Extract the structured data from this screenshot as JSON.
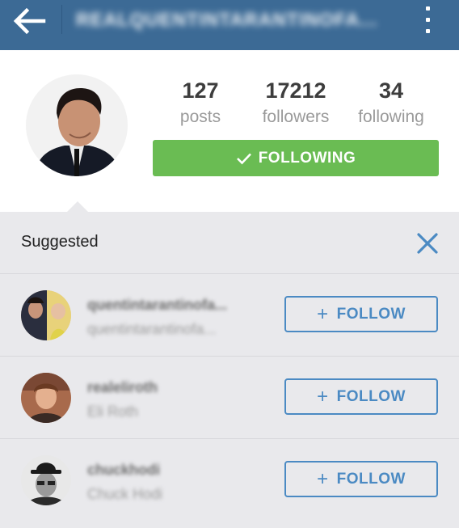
{
  "topbar": {
    "back_icon": "arrow-left-icon",
    "title": "REALQUENTINTARANTINOFA...",
    "menu_icon": "more-vertical-icon"
  },
  "profile": {
    "stats": [
      {
        "value": "127",
        "label": "posts"
      },
      {
        "value": "17212",
        "label": "followers"
      },
      {
        "value": "34",
        "label": "following"
      }
    ],
    "following_button": "FOLLOWING",
    "following_color": "#6abc53"
  },
  "suggested": {
    "title": "Suggested",
    "close_icon": "close-icon",
    "follow_label": "FOLLOW",
    "accent_color": "#4b8ac3",
    "users": [
      {
        "username": "quentintarantinofa...",
        "name": "quentintarantinofa..."
      },
      {
        "username": "realeliroth",
        "name": "Eli Roth"
      },
      {
        "username": "chuckhodi",
        "name": "Chuck Hodi"
      }
    ]
  },
  "colors": {
    "topbar": "#3c6a95",
    "panel": "#e9e9ec"
  }
}
